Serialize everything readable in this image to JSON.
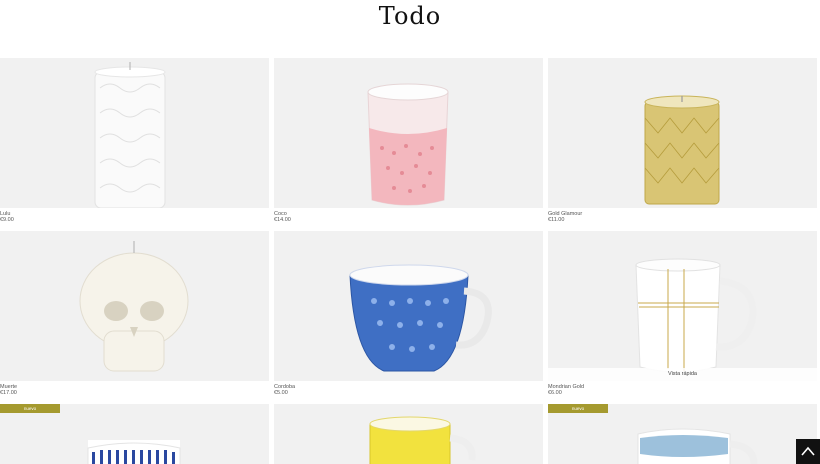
{
  "page": {
    "title": "Todo"
  },
  "products": [
    {
      "name": "Lulu",
      "price": "€9.00"
    },
    {
      "name": "Coco",
      "price": "€14.00"
    },
    {
      "name": "Gold Glamour",
      "price": "€11.00"
    },
    {
      "name": "Muerte",
      "price": "€17.00"
    },
    {
      "name": "Cordoba",
      "price": "€5.00"
    },
    {
      "name": "Mondrian Gold",
      "price": "€6.00",
      "quick_view": "Vista rápida"
    }
  ],
  "badges": {
    "new": "nuevo"
  },
  "colors": {
    "badge": "#a59a2f",
    "tile_bg": "#f1f1f1",
    "gold": "#c9b45a"
  },
  "icons": {
    "scroll_top": "chevron-up-icon"
  }
}
